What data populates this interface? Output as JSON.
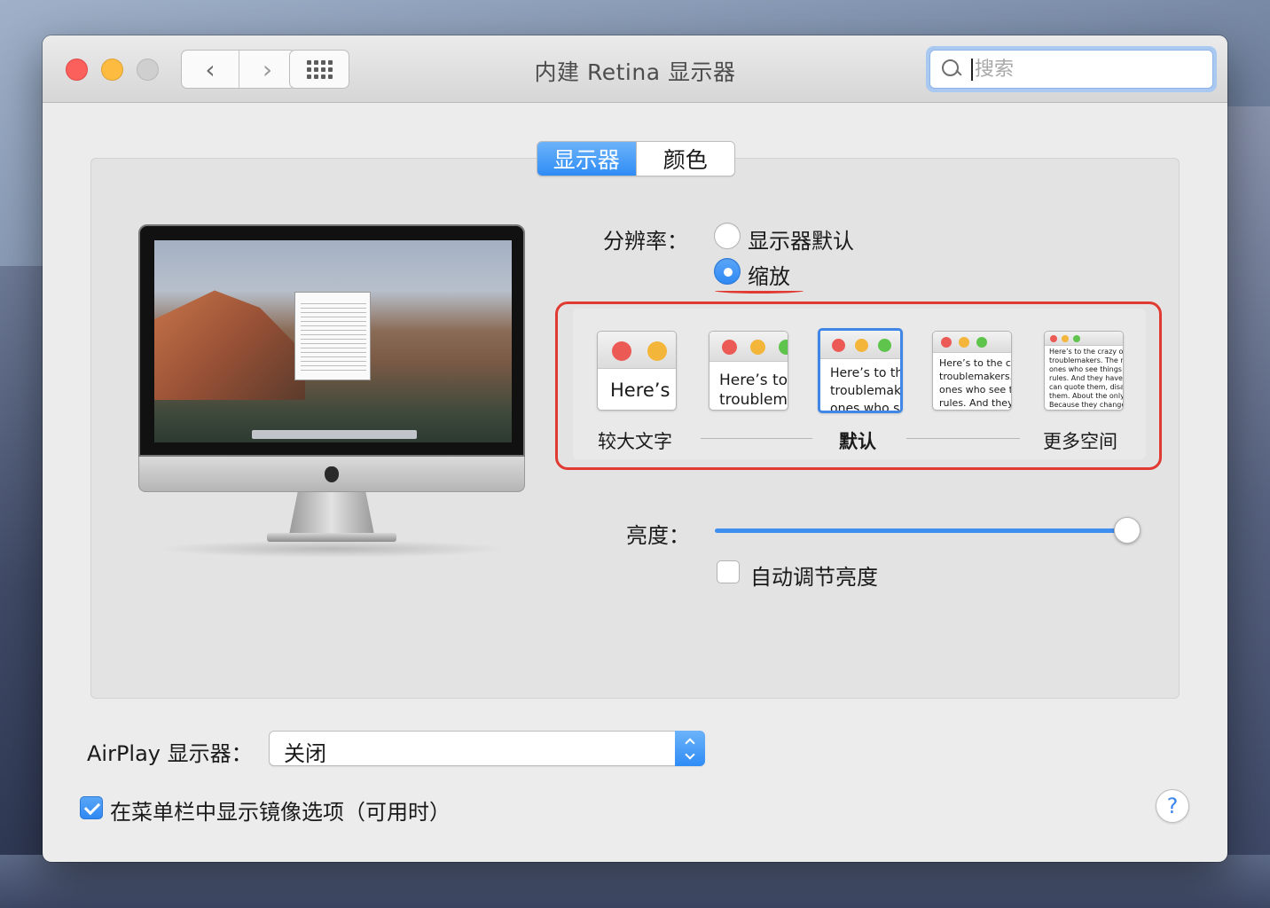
{
  "window": {
    "title": "内建 Retina 显示器"
  },
  "toolbar": {
    "back_glyph": "‹",
    "forward_glyph": "›",
    "search_placeholder": "搜索"
  },
  "tabs": [
    {
      "label": "显示器",
      "active": true
    },
    {
      "label": "颜色",
      "active": false
    }
  ],
  "resolution": {
    "label": "分辨率：",
    "options": [
      {
        "label": "显示器默认",
        "selected": false
      },
      {
        "label": "缩放",
        "selected": true
      }
    ]
  },
  "scaling": {
    "thumbs": [
      {
        "text": "Here’s"
      },
      {
        "text": "Here’s to\ntroublem"
      },
      {
        "text": "Here’s to th\ntroublemak\nones who s"
      },
      {
        "text": "Here’s to the cr\ntroublemakers.\nones who see t\nrules. And they"
      },
      {
        "text": "Here’s to the crazy one\ntroublemakers. The rou\nones who see things di\nrules. And they have no\ncan quote them, disagr\nthem. About the only th\nBecause they change t"
      }
    ],
    "selected_index": 2,
    "labels": {
      "larger_text": "较大文字",
      "default": "默认",
      "more_space": "更多空间"
    }
  },
  "brightness": {
    "label": "亮度：",
    "value_fraction": 1.0,
    "auto_label": "自动调节亮度",
    "auto_checked": false
  },
  "airplay": {
    "label": "AirPlay 显示器：",
    "selected": "关闭"
  },
  "mirroring": {
    "label": "在菜单栏中显示镜像选项（可用时）",
    "checked": true
  },
  "help": {
    "glyph": "?"
  },
  "colors": {
    "accent": "#2f8cf5",
    "annotation_red": "#e03a33",
    "close": "#fc605c",
    "minimize": "#fdbc40"
  }
}
